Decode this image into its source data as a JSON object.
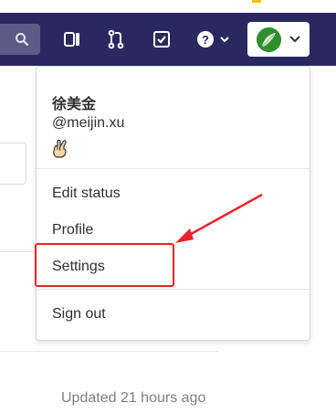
{
  "header": {
    "search_icon": "search-icon",
    "icons": [
      "issues-icon",
      "merge-requests-icon",
      "todos-icon",
      "help-icon"
    ],
    "accent_color": "#292961"
  },
  "user": {
    "display_name": "徐美金",
    "handle": "@meijin.xu",
    "status_emoji": "🤞"
  },
  "menu": {
    "edit_status": "Edit status",
    "profile": "Profile",
    "settings": "Settings",
    "sign_out": "Sign out"
  },
  "background": {
    "updated_text": "Updated 21 hours ago"
  },
  "annotation": {
    "highlight_color": "#e8222a"
  }
}
